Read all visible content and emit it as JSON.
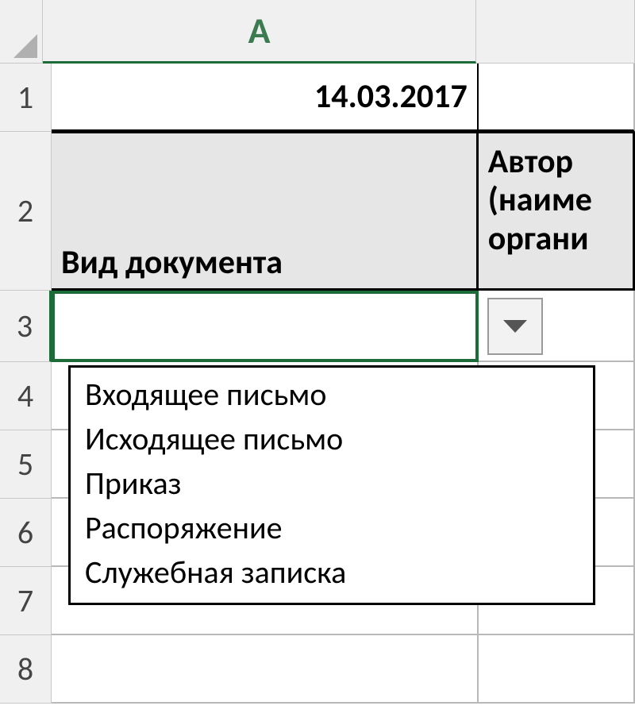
{
  "columns": {
    "A": "A",
    "B": ""
  },
  "rows": {
    "r1": "1",
    "r2": "2",
    "r3": "3",
    "r4": "4",
    "r5": "5",
    "r6": "6",
    "r7": "7",
    "r8": "8"
  },
  "cells": {
    "A1": "14.03.2017",
    "A2": "Вид документа",
    "B2": "Автор\n(наиме\nоргани",
    "A3": ""
  },
  "dropdown": {
    "items": [
      "Входящее письмо",
      "Исходящее письмо",
      "Приказ",
      "Распоряжение",
      "Служебная записка"
    ]
  }
}
